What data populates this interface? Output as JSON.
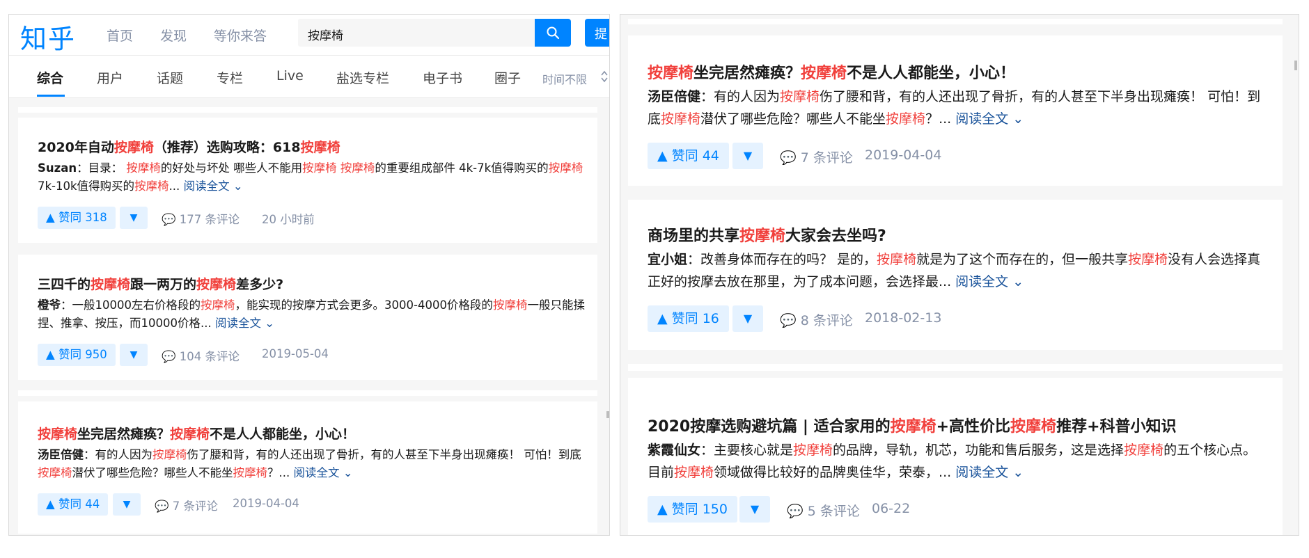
{
  "header": {
    "logo": "知乎",
    "nav": [
      "首页",
      "发现",
      "等你来答"
    ],
    "search_value": "按摩椅",
    "ask_label": "提"
  },
  "tabs": {
    "items": [
      "综合",
      "用户",
      "话题",
      "专栏",
      "Live",
      "盐选专栏",
      "电子书",
      "圈子"
    ],
    "time_filter": "时间不限"
  },
  "cards": [
    {
      "title_parts": [
        "2020年自动",
        "按摩椅",
        "（推荐）选购攻略：618",
        "按摩椅"
      ],
      "author": "Suzan",
      "excerpt_parts": [
        "：目录： ",
        "按摩椅",
        "的好处与坏处 哪些人不能用",
        "按摩椅",
        " ",
        "按摩椅",
        "的重要组成部件 4k-7k值得购买的",
        "按摩椅",
        " 7k-10k值得购买的",
        "按摩椅",
        "..."
      ],
      "read_more": "阅读全文",
      "votes": "赞同 318",
      "comments": "177 条评论",
      "time": "20 小时前"
    },
    {
      "title_parts": [
        "三四千的",
        "按摩椅",
        "跟一两万的",
        "按摩椅",
        "差多少?"
      ],
      "author": "橙爷",
      "excerpt_parts": [
        "：一般10000左右价格段的",
        "按摩椅",
        "，能实现的按摩方式会更多。3000-4000价格段的",
        "按摩椅",
        "一般只能揉捏、推拿、按压，而10000价格..."
      ],
      "read_more": "阅读全文",
      "votes": "赞同 950",
      "comments": "104 条评论",
      "time": "2019-05-04"
    },
    {
      "title_parts": [
        "按摩椅",
        "坐完居然瘫痪？",
        "按摩椅",
        "不是人人都能坐，小心！"
      ],
      "author": "汤臣倍健",
      "excerpt_parts": [
        "：有的人因为",
        "按摩椅",
        "伤了腰和背，有的人还出现了骨折，有的人甚至下半身出现瘫痪！ 可怕！到底",
        "按摩椅",
        "潜伏了哪些危险？哪些人不能坐",
        "按摩椅",
        "？..."
      ],
      "read_more": "阅读全文",
      "votes": "赞同 44",
      "comments": "7 条评论",
      "time": "2019-04-04"
    },
    {
      "title_parts": [
        "商场里的共享",
        "按摩椅",
        "大家会去坐吗?"
      ],
      "author": "宜小姐",
      "excerpt_parts": [
        "：改善身体而存在的吗？ 是的，",
        "按摩椅",
        "就是为了这个而存在的，但一般共享",
        "按摩椅",
        "没有人会选择真正好的按摩去放在那里，为了成本问题，会选择最..."
      ],
      "read_more": "阅读全文",
      "votes": "赞同 16",
      "comments": "8 条评论",
      "time": "2018-02-13"
    },
    {
      "title_parts": [
        "2020按摩选购避坑篇 | 适合家用的",
        "按摩椅",
        "+高性价比",
        "按摩椅",
        "推荐+科普小知识"
      ],
      "author": "紫霞仙女",
      "excerpt_parts": [
        "：主要核心就是",
        "按摩椅",
        "的品牌，导轨，机芯，功能和售后服务，这是选择",
        "按摩椅",
        "的五个核心点。目前",
        "按摩椅",
        "领域做得比较好的品牌奥佳华，荣泰，..."
      ],
      "read_more": "阅读全文",
      "votes": "赞同 150",
      "comments": "5 条评论",
      "time": "06-22"
    }
  ],
  "colors": {
    "brand": "#0084ff",
    "highlight": "#f1403c",
    "link": "#175199",
    "meta": "#8590a6"
  }
}
